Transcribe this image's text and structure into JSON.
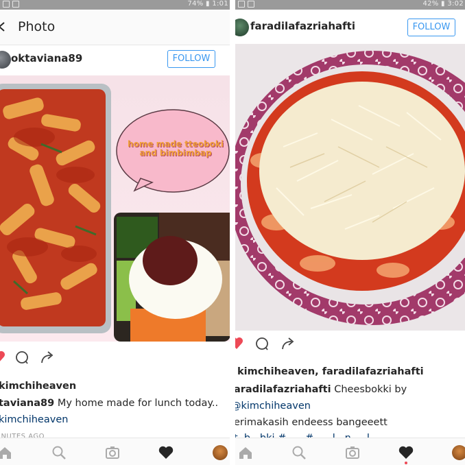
{
  "left": {
    "status": {
      "text": "74% ▮ 1:01"
    },
    "title": "Photo",
    "post": {
      "username": "oktaviana89",
      "follow_label": "FOLLOW",
      "bubble_text": "home made tteoboki and bimbimbap",
      "likes": "kimchiheaven",
      "caption_user": "taviana89",
      "caption_text": " My home made for lunch today..",
      "caption_tag": "kimchiheaven",
      "time": "INUTES AGO"
    }
  },
  "right": {
    "status": {
      "text": "42% ▮ 3:02"
    },
    "post": {
      "username": "faradilafazriahafti",
      "follow_label": "FOLLOW",
      "likes": "kimchiheaven, faradilafazriahafti",
      "caption_user": "aradilafazriahafti",
      "caption_text": " Cheesbokki by",
      "caption_tag": "@kimchiheaven",
      "caption_line3": "erimakasih endeess bangeeett",
      "caption_line4": "t..b...bki #......#......l...n.....l"
    }
  },
  "colors": {
    "accent": "#3897f0",
    "like_red": "#ed4956",
    "tag_blue": "#003569"
  },
  "icons": {
    "like": "heart-icon",
    "comment": "comment-icon",
    "share": "share-icon",
    "home": "home-icon",
    "search": "search-icon",
    "camera": "camera-icon",
    "activity": "heart-icon",
    "profile": "avatar"
  }
}
